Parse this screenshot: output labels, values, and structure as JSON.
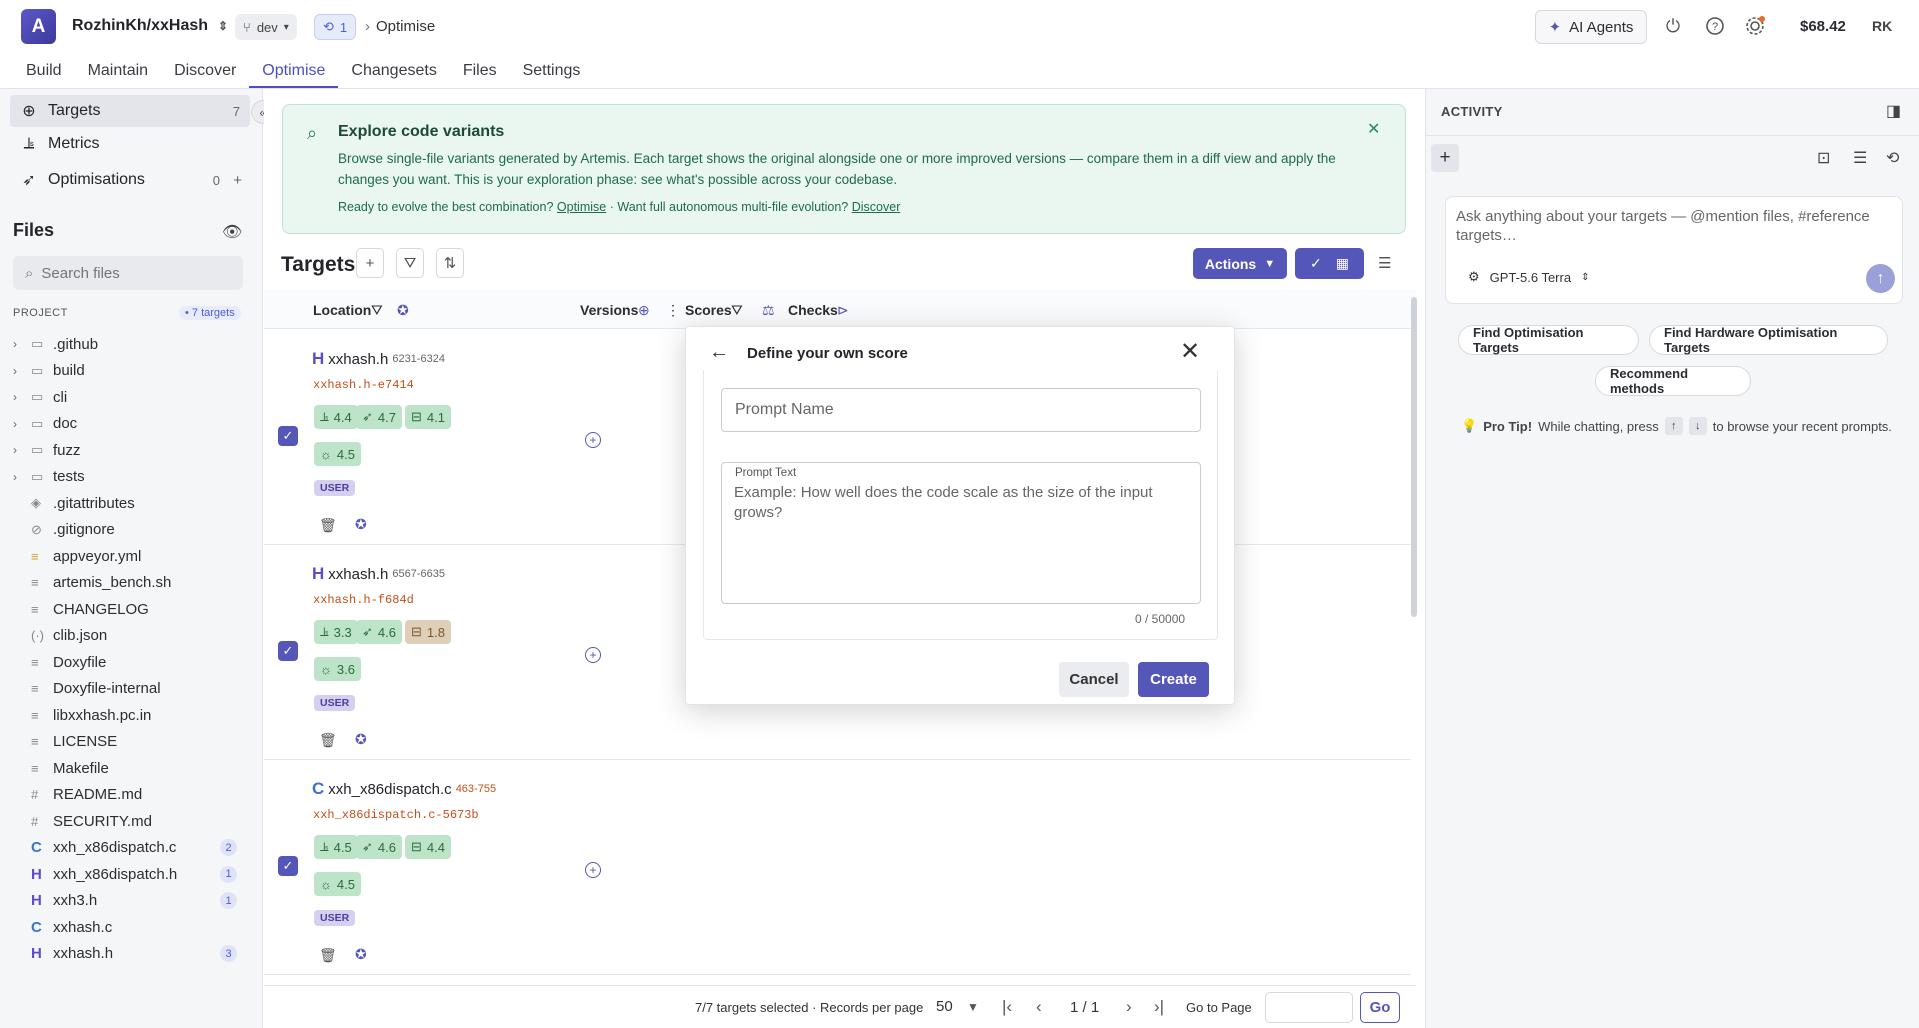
{
  "header": {
    "logo_letter": "A",
    "repo": "RozhinKh/xxHash",
    "branch": "dev",
    "pr_count": "1",
    "breadcrumb": "Optimise",
    "ai_agents_label": "AI Agents",
    "balance": "$68.42",
    "avatar_initials": "RK"
  },
  "nav": {
    "tabs": [
      "Build",
      "Maintain",
      "Discover",
      "Optimise",
      "Changesets",
      "Files",
      "Settings"
    ],
    "active": "Optimise"
  },
  "sidebar": {
    "items": [
      {
        "label": "Targets",
        "count": "7"
      },
      {
        "label": "Metrics",
        "count": ""
      },
      {
        "label": "Optimisations",
        "count": "0"
      }
    ],
    "files_heading": "Files",
    "search_placeholder": "Search files",
    "project_label": "PROJECT",
    "project_badge": "• 7 targets",
    "tree": [
      {
        "name": ".github",
        "type": "folder",
        "badge": ""
      },
      {
        "name": "build",
        "type": "folder",
        "badge": ""
      },
      {
        "name": "cli",
        "type": "folder",
        "badge": ""
      },
      {
        "name": "doc",
        "type": "folder",
        "badge": ""
      },
      {
        "name": "fuzz",
        "type": "folder",
        "badge": ""
      },
      {
        "name": "tests",
        "type": "folder",
        "badge": ""
      },
      {
        "name": ".gitattributes",
        "type": "file",
        "badge": ""
      },
      {
        "name": ".gitignore",
        "type": "file",
        "badge": ""
      },
      {
        "name": "appveyor.yml",
        "type": "yml",
        "badge": ""
      },
      {
        "name": "artemis_bench.sh",
        "type": "file",
        "badge": ""
      },
      {
        "name": "CHANGELOG",
        "type": "file",
        "badge": ""
      },
      {
        "name": "clib.json",
        "type": "json",
        "badge": ""
      },
      {
        "name": "Doxyfile",
        "type": "file",
        "badge": ""
      },
      {
        "name": "Doxyfile-internal",
        "type": "file",
        "badge": ""
      },
      {
        "name": "libxxhash.pc.in",
        "type": "file",
        "badge": ""
      },
      {
        "name": "LICENSE",
        "type": "file",
        "badge": ""
      },
      {
        "name": "Makefile",
        "type": "file",
        "badge": ""
      },
      {
        "name": "README.md",
        "type": "md",
        "badge": ""
      },
      {
        "name": "SECURITY.md",
        "type": "md",
        "badge": ""
      },
      {
        "name": "xxh_x86dispatch.c",
        "type": "c",
        "badge": "2"
      },
      {
        "name": "xxh_x86dispatch.h",
        "type": "h",
        "badge": "1"
      },
      {
        "name": "xxh3.h",
        "type": "h",
        "badge": "1"
      },
      {
        "name": "xxhash.c",
        "type": "c",
        "badge": ""
      },
      {
        "name": "xxhash.h",
        "type": "h",
        "badge": "3"
      }
    ]
  },
  "banner": {
    "title": "Explore code variants",
    "text": "Browse single-file variants generated by Artemis. Each target shows the original alongside one or more improved versions — compare them in a diff view and apply the changes you want. This is your exploration phase: see what's possible across your codebase.",
    "cta_prefix": "Ready to evolve the best combination?",
    "cta_link1": "Optimise",
    "cta_mid": "· Want full autonomous multi-file evolution?",
    "cta_link2": "Discover"
  },
  "targets": {
    "heading": "Targets",
    "actions_label": "Actions",
    "columns": [
      "Location",
      "Versions",
      "Scores",
      "Checks"
    ],
    "rows": [
      {
        "icon": "H",
        "file": "xxhash.h",
        "range": "6231-6324",
        "variant": "xxhash.h-e7414",
        "scores": [
          "4.4",
          "4.7",
          "4.1",
          "4.5"
        ],
        "warn": [
          false,
          false,
          false,
          false
        ],
        "tag": "USER"
      },
      {
        "icon": "H",
        "file": "xxhash.h",
        "range": "6567-6635",
        "variant": "xxhash.h-f684d",
        "scores": [
          "3.3",
          "4.6",
          "1.8",
          "3.6"
        ],
        "warn": [
          false,
          false,
          true,
          false
        ],
        "tag": "USER"
      },
      {
        "icon": "C",
        "file": "xxh_x86dispatch.c",
        "range": "463-755",
        "variant": "xxh_x86dispatch.c-5673b",
        "scores": [
          "4.5",
          "4.6",
          "4.4",
          "4.5"
        ],
        "warn": [
          false,
          false,
          false,
          false
        ],
        "tag": "USER"
      }
    ]
  },
  "footer": {
    "selected": "7/7 targets selected · Records per page",
    "per_page": "50",
    "page": "1 / 1",
    "goto_label": "Go to Page",
    "go_label": "Go"
  },
  "modal": {
    "title": "Define your own score",
    "name_placeholder": "Prompt Name",
    "text_label": "Prompt Text",
    "text_placeholder": "Example: How well does the code scale as the size of the input grows?",
    "counter": "0 / 50000",
    "cancel_label": "Cancel",
    "create_label": "Create"
  },
  "activity": {
    "heading": "ACTIVITY",
    "chat_placeholder": "Ask anything about your targets — @mention files, #reference targets…",
    "model": "GPT-5.6 Terra",
    "suggestions": [
      "Find Optimisation Targets",
      "Find Hardware Optimisation Targets",
      "Recommend methods"
    ],
    "tip_bold": "Pro Tip!",
    "tip_text": "While chatting, press",
    "tip_end": "to browse your recent prompts."
  },
  "colors": {
    "accent": "#5456b8",
    "banner_bg": "#eaf7f1",
    "score_good": "#bde4c8",
    "score_warn": "#e0cfb8"
  }
}
